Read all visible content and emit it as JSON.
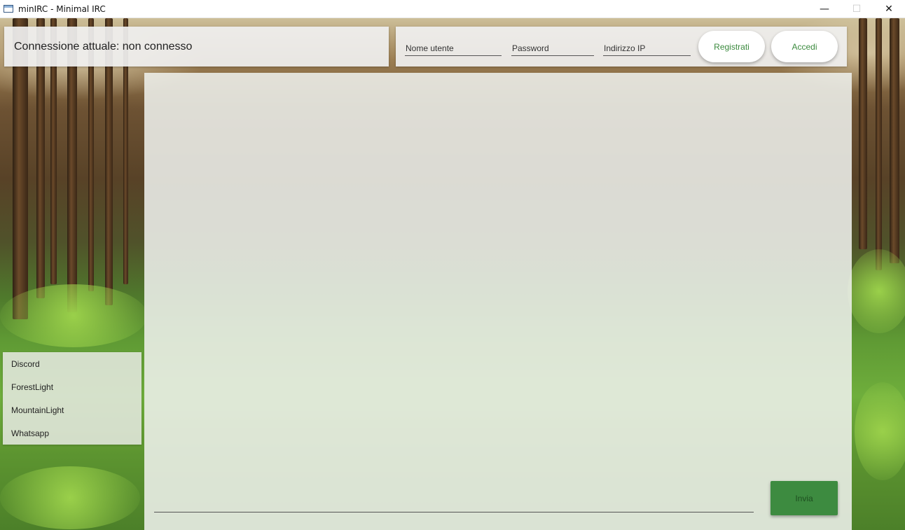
{
  "window": {
    "title": "minIRC - Minimal IRC",
    "minimize": "—",
    "maximize": "☐",
    "close": "✕"
  },
  "status": {
    "text": "Connessione attuale: non connesso"
  },
  "login": {
    "username_placeholder": "Nome utente",
    "password_placeholder": "Password",
    "ip_placeholder": "Indirizzo IP",
    "register_label": "Registrati",
    "login_label": "Accedi"
  },
  "themes": {
    "items": [
      {
        "label": "Discord"
      },
      {
        "label": "ForestLight"
      },
      {
        "label": "MountainLight"
      },
      {
        "label": "Whatsapp"
      }
    ]
  },
  "chat": {
    "message_value": "",
    "send_label": "Invia"
  },
  "colors": {
    "accent": "#3d8b40",
    "accent_text": "#3b8a3e"
  }
}
